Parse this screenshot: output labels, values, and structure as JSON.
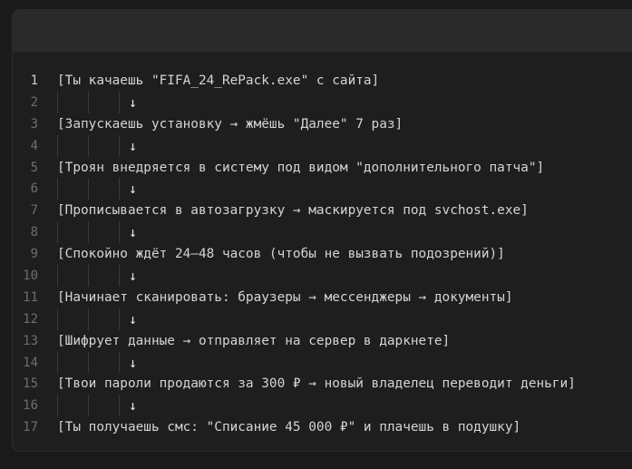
{
  "editor": {
    "lines": [
      {
        "num": "1",
        "text": "[Ты качаешь \"FIFA_24_RePack.exe\" с сайта]"
      },
      {
        "num": "2",
        "arrow": "↓"
      },
      {
        "num": "3",
        "text": "[Запускаешь установку → жмёшь \"Далее\" 7 раз]"
      },
      {
        "num": "4",
        "arrow": "↓"
      },
      {
        "num": "5",
        "text": "[Троян внедряется в систему под видом \"дополнительного патча\"]"
      },
      {
        "num": "6",
        "arrow": "↓"
      },
      {
        "num": "7",
        "text": "[Прописывается в автозагрузку → маскируется под svchost.exe]"
      },
      {
        "num": "8",
        "arrow": "↓"
      },
      {
        "num": "9",
        "text": "[Спокойно ждёт 24–48 часов (чтобы не вызвать подозрений)]"
      },
      {
        "num": "10",
        "arrow": "↓"
      },
      {
        "num": "11",
        "text": "[Начинает сканировать: браузеры → мессенджеры → документы]"
      },
      {
        "num": "12",
        "arrow": "↓"
      },
      {
        "num": "13",
        "text": "[Шифрует данные → отправляет на сервер в даркнете]"
      },
      {
        "num": "14",
        "arrow": "↓"
      },
      {
        "num": "15",
        "text": "[Твои пароли продаются за 300 ₽ → новый владелец переводит деньги]"
      },
      {
        "num": "16",
        "arrow": "↓"
      },
      {
        "num": "17",
        "text": "[Ты получаешь смс: \"Списание 45 000 ₽\" и плачешь в подушку]"
      }
    ]
  }
}
